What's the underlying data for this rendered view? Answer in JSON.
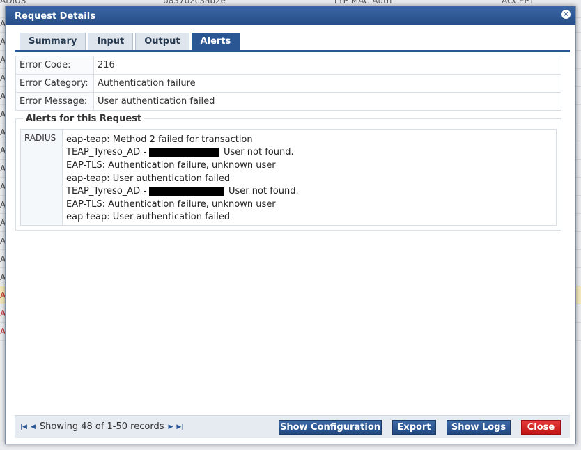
{
  "background": {
    "header_cells": [
      "ADIUS",
      "b837b2c3ab2e",
      "TYP MAC Auth",
      "ACCEPT"
    ],
    "row_initials": [
      "A",
      "A",
      "A",
      "A",
      "A",
      "A",
      "A",
      "A",
      "A",
      "A",
      "A",
      "A",
      "A",
      "A",
      "A",
      "A",
      "A",
      "A"
    ]
  },
  "modal": {
    "title": "Request Details",
    "close_label": "×"
  },
  "tabs": [
    {
      "label": "Summary"
    },
    {
      "label": "Input"
    },
    {
      "label": "Output"
    },
    {
      "label": "Alerts",
      "active": true
    }
  ],
  "error": {
    "code_label": "Error Code:",
    "code_value": "216",
    "category_label": "Error Category:",
    "category_value": "Authentication failure",
    "message_label": "Error Message:",
    "message_value": "User authentication failed"
  },
  "alerts": {
    "legend": "Alerts for this Request",
    "source": "RADIUS",
    "lines": [
      {
        "text": "eap-teap: Method 2 failed for transaction"
      },
      {
        "prefix": "TEAP_Tyreso_AD -",
        "suffix": "User not found.",
        "redacted": true
      },
      {
        "text": "EAP-TLS: Authentication failure, unknown user"
      },
      {
        "text": "eap-teap: User authentication failed"
      },
      {
        "prefix": "TEAP_Tyreso_AD -",
        "suffix": "User not found.",
        "redacted": true
      },
      {
        "text": "EAP-TLS: Authentication failure, unknown user"
      },
      {
        "text": "eap-teap: User authentication failed"
      }
    ]
  },
  "footer": {
    "pager_text": "Showing 48 of 1-50 records",
    "buttons": {
      "show_configuration": "Show Configuration",
      "export": "Export",
      "show_logs": "Show Logs",
      "close": "Close"
    }
  },
  "colors": {
    "header_blue": "#2a5693",
    "close_red": "#d01c1c",
    "highlight_row": "#f4e7bc"
  }
}
